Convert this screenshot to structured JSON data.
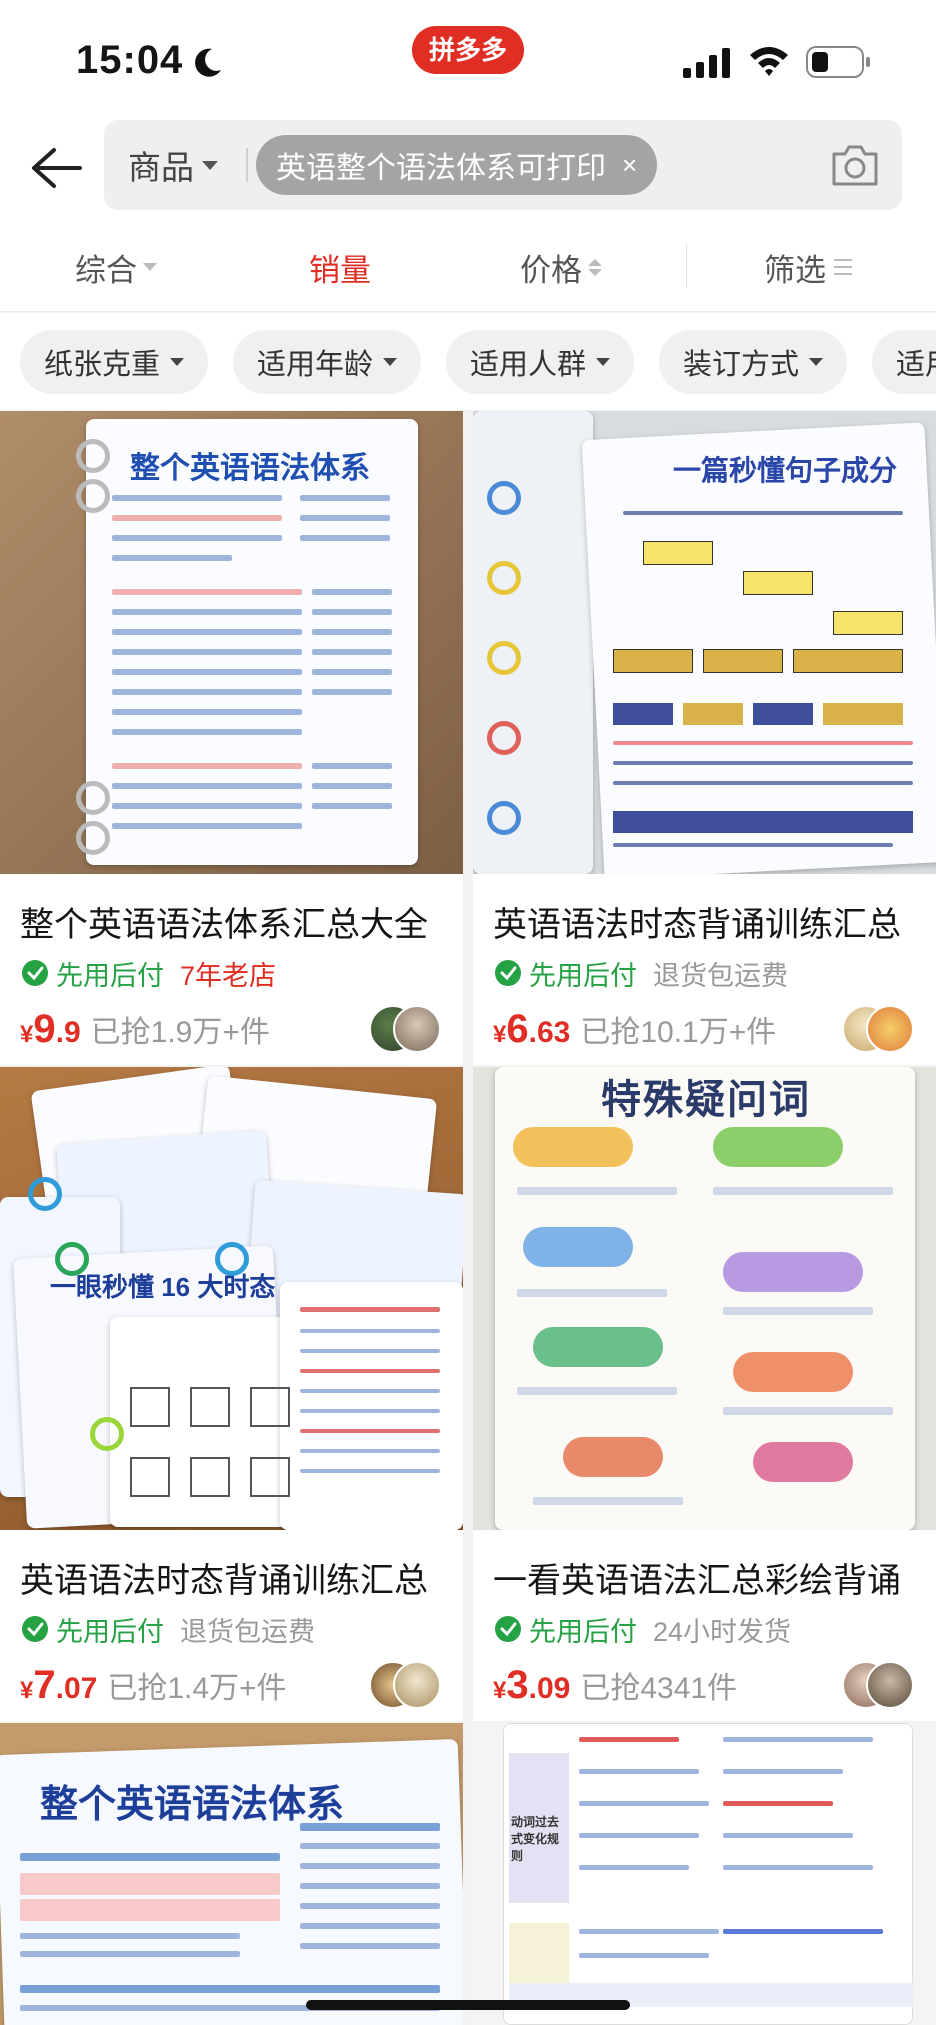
{
  "status_bar": {
    "time": "15:04",
    "app_pill": "拼多多"
  },
  "search": {
    "category": "商品",
    "query": "英语整个语法体系可打印",
    "clear_glyph": "×"
  },
  "sort_tabs": [
    {
      "label": "综合",
      "active": false
    },
    {
      "label": "销量",
      "active": true
    },
    {
      "label": "价格",
      "active": false
    },
    {
      "label": "筛选",
      "active": false
    }
  ],
  "filter_chips": [
    "纸张克重",
    "适用年龄",
    "适用人群",
    "装订方式",
    "适用"
  ],
  "products": [
    {
      "title": "整个英语语法体系汇总大全",
      "badge": "先用后付",
      "extra": "7年老店",
      "extra_highlight": true,
      "price_currency": "¥",
      "price_int": "9",
      "price_dec": ".9",
      "sold": "已抢1.9万+件",
      "image_title": "整个英语语法体系"
    },
    {
      "title": "英语语法时态背诵训练汇总",
      "badge": "先用后付",
      "extra": "退货包运费",
      "extra_highlight": false,
      "price_currency": "¥",
      "price_int": "6",
      "price_dec": ".63",
      "sold": "已抢10.1万+件",
      "image_title": "一篇秒懂句子成分"
    },
    {
      "title": "英语语法时态背诵训练汇总",
      "badge": "先用后付",
      "extra": "退货包运费",
      "extra_highlight": false,
      "price_currency": "¥",
      "price_int": "7",
      "price_dec": ".07",
      "sold": "已抢1.4万+件",
      "image_title": "一眼秒懂 16 大时态"
    },
    {
      "title": "一看英语语法汇总彩绘背诵",
      "badge": "先用后付",
      "extra": "24小时发货",
      "extra_highlight": false,
      "price_currency": "¥",
      "price_int": "3",
      "price_dec": ".09",
      "sold": "已抢4341件",
      "image_title": "特殊疑问词"
    },
    {
      "image_title": "整个英语语法体系"
    },
    {
      "image_title": "动词过去式变化规则"
    }
  ],
  "colors": {
    "brand_red": "#e02e24",
    "badge_green": "#25a244",
    "muted_gray": "#999999"
  }
}
